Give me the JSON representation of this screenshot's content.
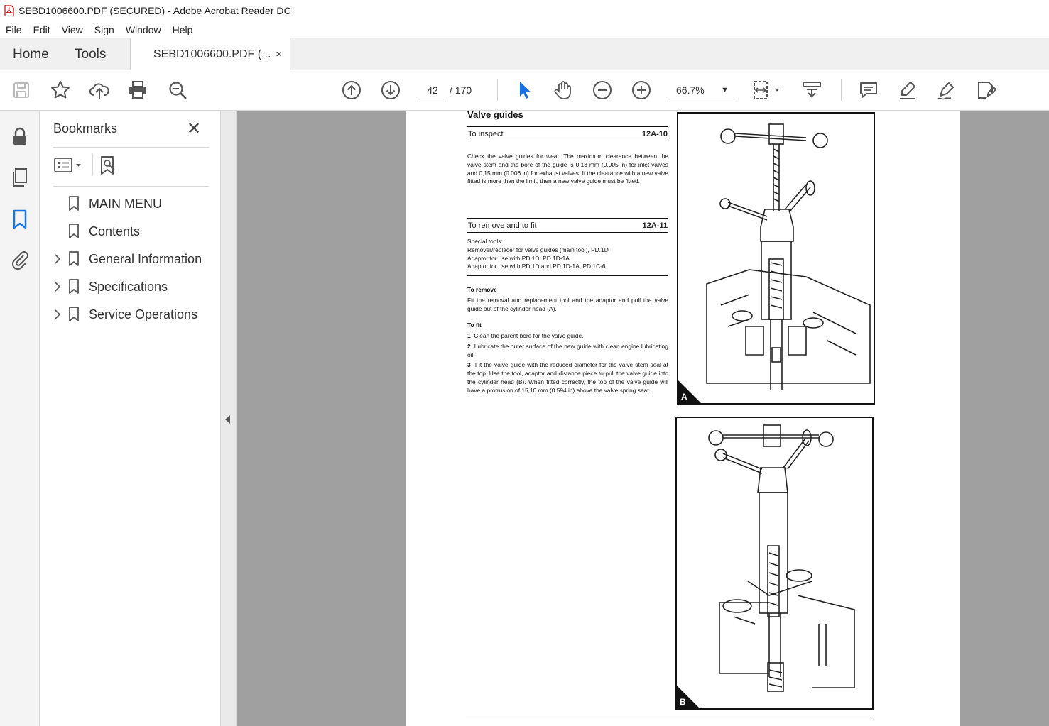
{
  "window": {
    "title": "SEBD1006600.PDF (SECURED) - Adobe Acrobat Reader DC"
  },
  "menu": [
    "File",
    "Edit",
    "View",
    "Sign",
    "Window",
    "Help"
  ],
  "tabs": {
    "home": "Home",
    "tools": "Tools",
    "document": "SEBD1006600.PDF (...",
    "close": "×"
  },
  "toolbar": {
    "page_current": "42",
    "page_total": "/ 170",
    "zoom": "66.7%",
    "icons": [
      "save-icon",
      "bookmark-star-icon",
      "upload-icon",
      "print-icon",
      "find-icon",
      "page-up-icon",
      "page-down-icon",
      "select-cursor-icon",
      "hand-icon",
      "zoom-out-icon",
      "zoom-in-icon",
      "page-fit-icon",
      "scroll-mode-icon",
      "comment-icon",
      "highlight-icon",
      "sign-icon",
      "fill-sign-icon"
    ]
  },
  "bookmarks": {
    "title": "Bookmarks",
    "close": "✕",
    "items": [
      {
        "label": "MAIN MENU",
        "expandable": false
      },
      {
        "label": "Contents",
        "expandable": false
      },
      {
        "label": "General Information",
        "expandable": true
      },
      {
        "label": "Specifications",
        "expandable": true
      },
      {
        "label": "Service Operations",
        "expandable": true
      }
    ]
  },
  "document": {
    "heading": "Valve guides",
    "sec1": {
      "title": "To inspect",
      "code": "12A-10"
    },
    "inspect_text": "Check the valve guides for wear. The maximum clearance between the valve stem and the bore of the guide is 0,13 mm (0.005 in) for inlet valves and 0,15 mm (0.006 in) for exhaust valves. If the clearance with a new valve fitted is more than the limit, then a new valve guide must be fitted.",
    "sec2": {
      "title": "To remove and to fit",
      "code": "12A-11"
    },
    "special_tools": [
      "Special tools:",
      "Remover/replacer for valve guides (main tool), PD.1D",
      "Adaptor for use with PD.1D, PD.1D-1A",
      "Adaptor for use with PD.1D and PD.1D-1A, PD.1C-6"
    ],
    "remove_heading": "To remove",
    "remove_text": "Fit the removal and replacement tool and the adaptor and pull the valve guide out of the cylinder head (A).",
    "fit_heading": "To fit",
    "fit_steps": [
      {
        "n": "1",
        "text": "Clean the parent bore for the valve guide."
      },
      {
        "n": "2",
        "text": "Lubricate the outer surface of the new guide with clean engine lubricating oil."
      },
      {
        "n": "3",
        "text": "Fit the valve guide with the reduced diameter for the valve stem seal at the top. Use the tool, adaptor and distance piece to pull the valve guide into the cylinder head (B). When fitted correctly, the top of the valve guide will have a protrusion of 15,10 mm (0.594 in) above the valve spring seat."
      }
    ],
    "figure_a": "A",
    "figure_b": "B"
  }
}
